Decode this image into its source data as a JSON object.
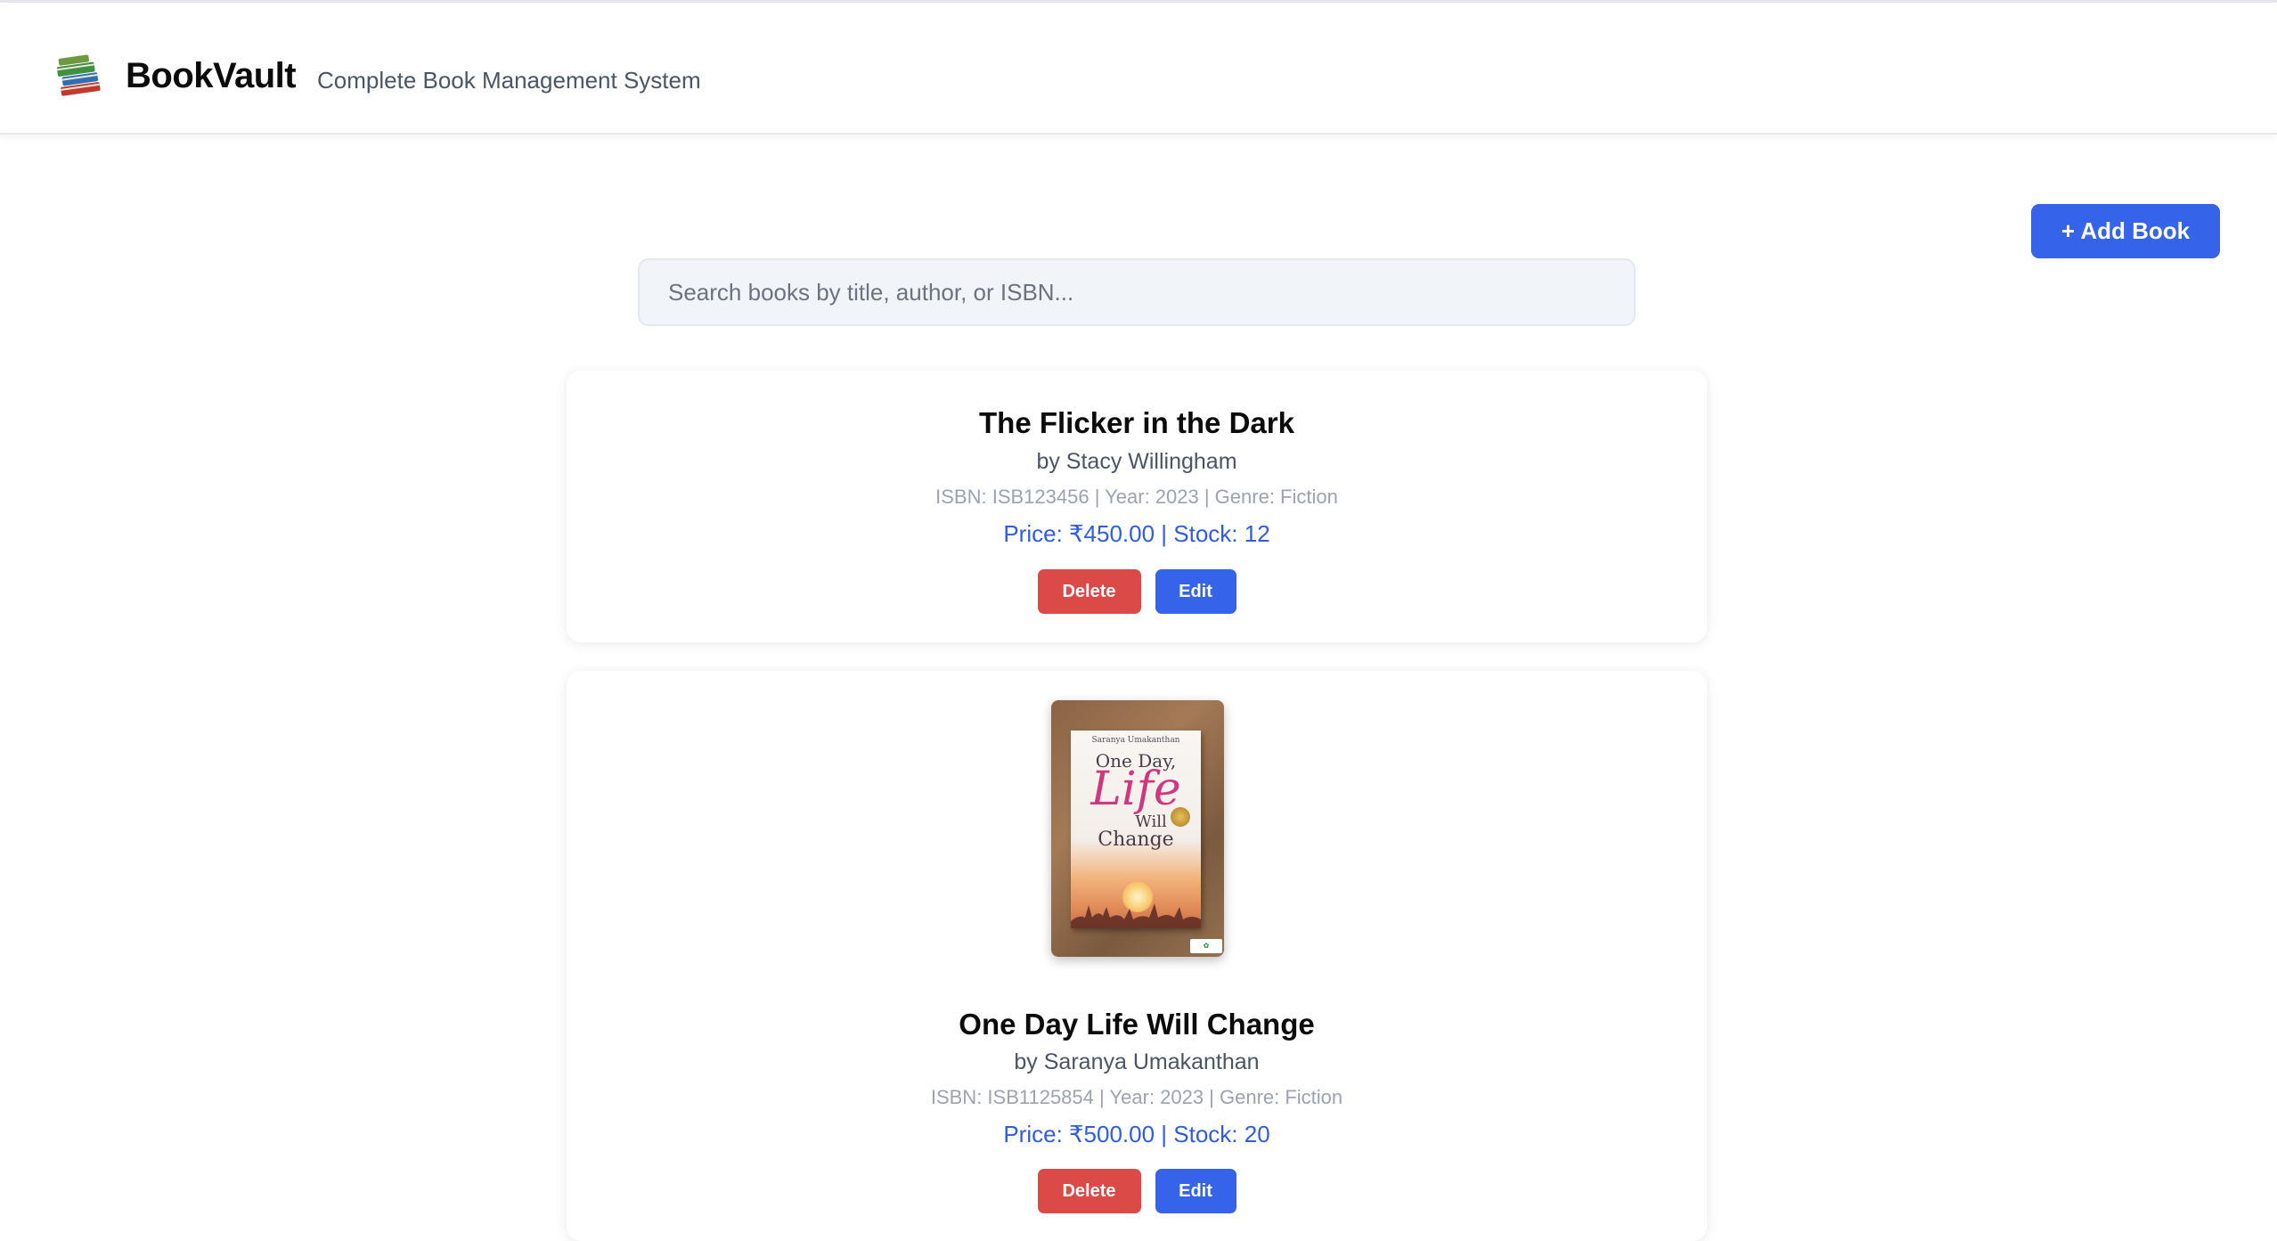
{
  "header": {
    "brand": "BookVault",
    "tagline": "Complete Book Management System",
    "logo_icon": "books-icon"
  },
  "toolbar": {
    "add_book_label": "+ Add Book"
  },
  "search": {
    "placeholder": "Search books by title, author, or ISBN...",
    "value": ""
  },
  "books": [
    {
      "title": "The Flicker in the Dark",
      "author": "by Stacy Willingham",
      "meta": "ISBN: ISB123456 | Year: 2023 | Genre: Fiction",
      "price_stock": "Price: ₹450.00 | Stock: 12",
      "delete_label": "Delete",
      "edit_label": "Edit"
    },
    {
      "title": "One Day Life Will Change",
      "author": "by Saranya Umakanthan",
      "meta": "ISBN: ISB1125854 | Year: 2023 | Genre: Fiction",
      "price_stock": "Price: ₹500.00 | Stock: 20",
      "delete_label": "Delete",
      "edit_label": "Edit",
      "cover": {
        "author": "Saranya Umakanthan",
        "line1": "One Day,",
        "line2": "Life",
        "line3": "Will",
        "line4": "Change"
      }
    }
  ],
  "colors": {
    "primary": "#3563e9",
    "danger": "#dc4a48",
    "price_text": "#2f5ce0"
  }
}
